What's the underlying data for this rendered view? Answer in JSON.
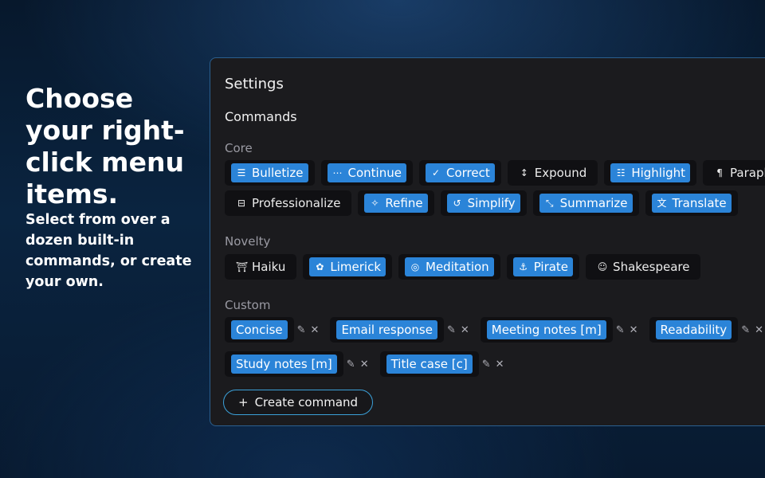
{
  "hero": {
    "title": "Choose your right-click menu items.",
    "subtitle": "Select from over a dozen built-in commands, or create your own."
  },
  "panel": {
    "title": "Settings",
    "section": "Commands",
    "groups": {
      "core": {
        "label": "Core",
        "row1": [
          {
            "label": "Bulletize",
            "icon": "list-icon",
            "glyph": "☰",
            "enabled": true
          },
          {
            "label": "Continue",
            "icon": "ellipsis-icon",
            "glyph": "⋯",
            "enabled": true
          },
          {
            "label": "Correct",
            "icon": "double-check-icon",
            "glyph": "✓",
            "enabled": true
          },
          {
            "label": "Expound",
            "icon": "expand-vertical-icon",
            "glyph": "↕",
            "enabled": false
          },
          {
            "label": "Highlight",
            "icon": "highlight-list-icon",
            "glyph": "☷",
            "enabled": true
          },
          {
            "label": "Paraphrase",
            "icon": "pilcrow-icon",
            "glyph": "¶",
            "enabled": false
          }
        ],
        "row2": [
          {
            "label": "Professionalize",
            "icon": "briefcase-icon",
            "glyph": "⊟",
            "enabled": false
          },
          {
            "label": "Refine",
            "icon": "magic-wand-icon",
            "glyph": "✧",
            "enabled": true
          },
          {
            "label": "Simplify",
            "icon": "spiral-icon",
            "glyph": "↺",
            "enabled": true
          },
          {
            "label": "Summarize",
            "icon": "shrink-icon",
            "glyph": "⤡",
            "enabled": true
          },
          {
            "label": "Translate",
            "icon": "translate-icon",
            "glyph": "文",
            "enabled": true
          }
        ]
      },
      "novelty": {
        "label": "Novelty",
        "items": [
          {
            "label": "Haiku",
            "icon": "torii-gate-icon",
            "glyph": "⛩",
            "enabled": false
          },
          {
            "label": "Limerick",
            "icon": "flower-icon",
            "glyph": "✿",
            "enabled": true
          },
          {
            "label": "Meditation",
            "icon": "yin-yang-icon",
            "glyph": "◎",
            "enabled": true
          },
          {
            "label": "Pirate",
            "icon": "anchor-icon",
            "glyph": "⚓",
            "enabled": true
          },
          {
            "label": "Shakespeare",
            "icon": "theater-masks-icon",
            "glyph": "☺",
            "enabled": false
          }
        ]
      },
      "custom": {
        "label": "Custom",
        "row1": [
          {
            "label": "Concise"
          },
          {
            "label": "Email response"
          },
          {
            "label": "Meeting notes [m]"
          },
          {
            "label": "Readability"
          }
        ],
        "row2": [
          {
            "label": "Study notes [m]"
          },
          {
            "label": "Title case [c]"
          }
        ]
      }
    },
    "create_button": {
      "label": "Create command",
      "glyph": "+"
    }
  },
  "colors": {
    "accent": "#2b84d8",
    "panel_border": "#2b5f8e",
    "panel_bg": "#1b1b1e"
  }
}
